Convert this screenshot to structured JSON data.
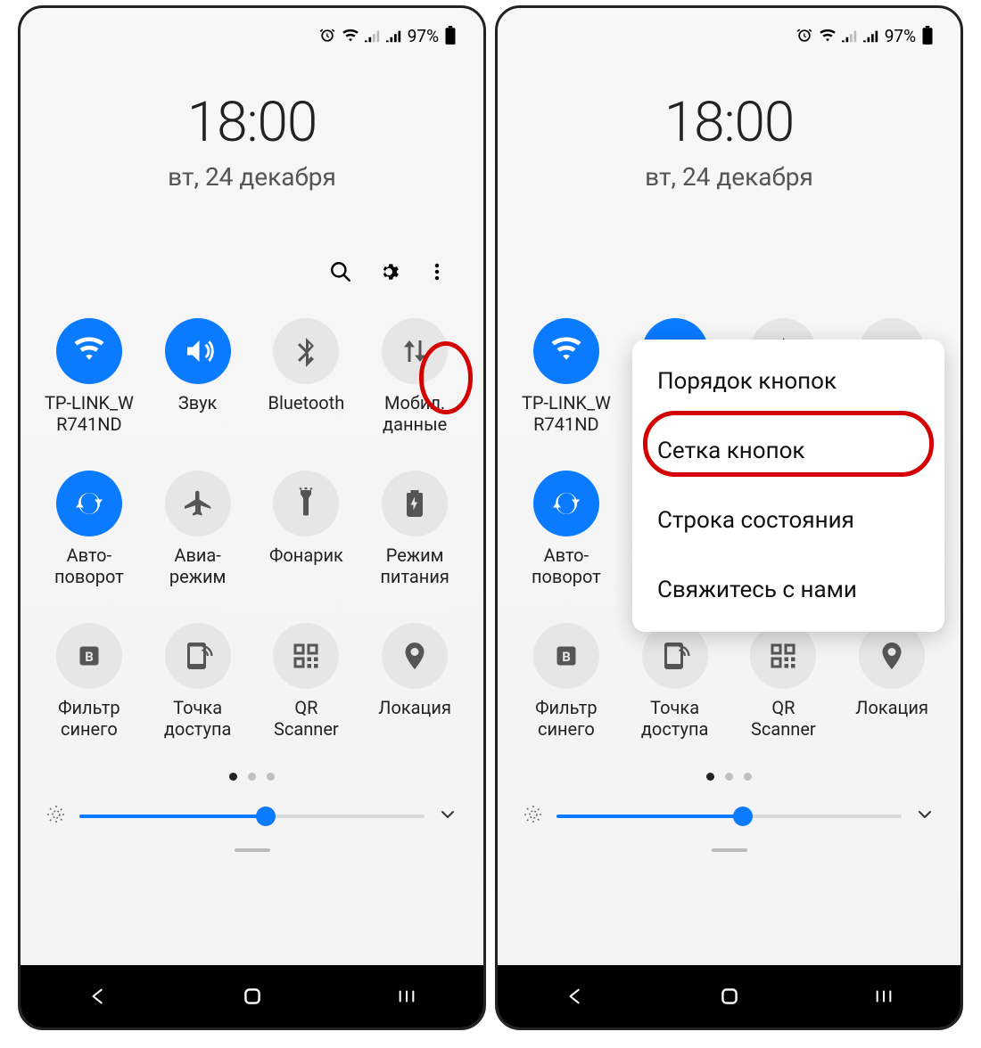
{
  "status": {
    "battery_pct": "97%"
  },
  "time": "18:00",
  "date": "вт, 24 декабря",
  "tiles": [
    {
      "label1": "TP-LINK_W",
      "label2": "R741ND",
      "icon": "wifi",
      "active": true
    },
    {
      "label1": "Звук",
      "label2": "",
      "icon": "sound",
      "active": true
    },
    {
      "label1": "Bluetooth",
      "label2": "",
      "icon": "bluetooth",
      "active": false
    },
    {
      "label1": "Мобил.",
      "label2": "данные",
      "icon": "data",
      "active": false
    },
    {
      "label1": "Авто-",
      "label2": "поворот",
      "icon": "rotate",
      "active": true
    },
    {
      "label1": "Авиа-",
      "label2": "режим",
      "icon": "airplane",
      "active": false
    },
    {
      "label1": "Фонарик",
      "label2": "",
      "icon": "flashlight",
      "active": false
    },
    {
      "label1": "Режим",
      "label2": "питания",
      "icon": "power",
      "active": false
    },
    {
      "label1": "Фильтр",
      "label2": "синего",
      "icon": "bluelight",
      "active": false
    },
    {
      "label1": "Точка",
      "label2": "доступа",
      "icon": "hotspot",
      "active": false
    },
    {
      "label1": "QR",
      "label2": "Scanner",
      "icon": "qr",
      "active": false
    },
    {
      "label1": "Локация",
      "label2": "",
      "icon": "location",
      "active": false
    }
  ],
  "brightness_pct": 54,
  "popup": {
    "items": [
      "Порядок кнопок",
      "Сетка кнопок",
      "Строка состояния",
      "Свяжитесь с нами"
    ]
  }
}
